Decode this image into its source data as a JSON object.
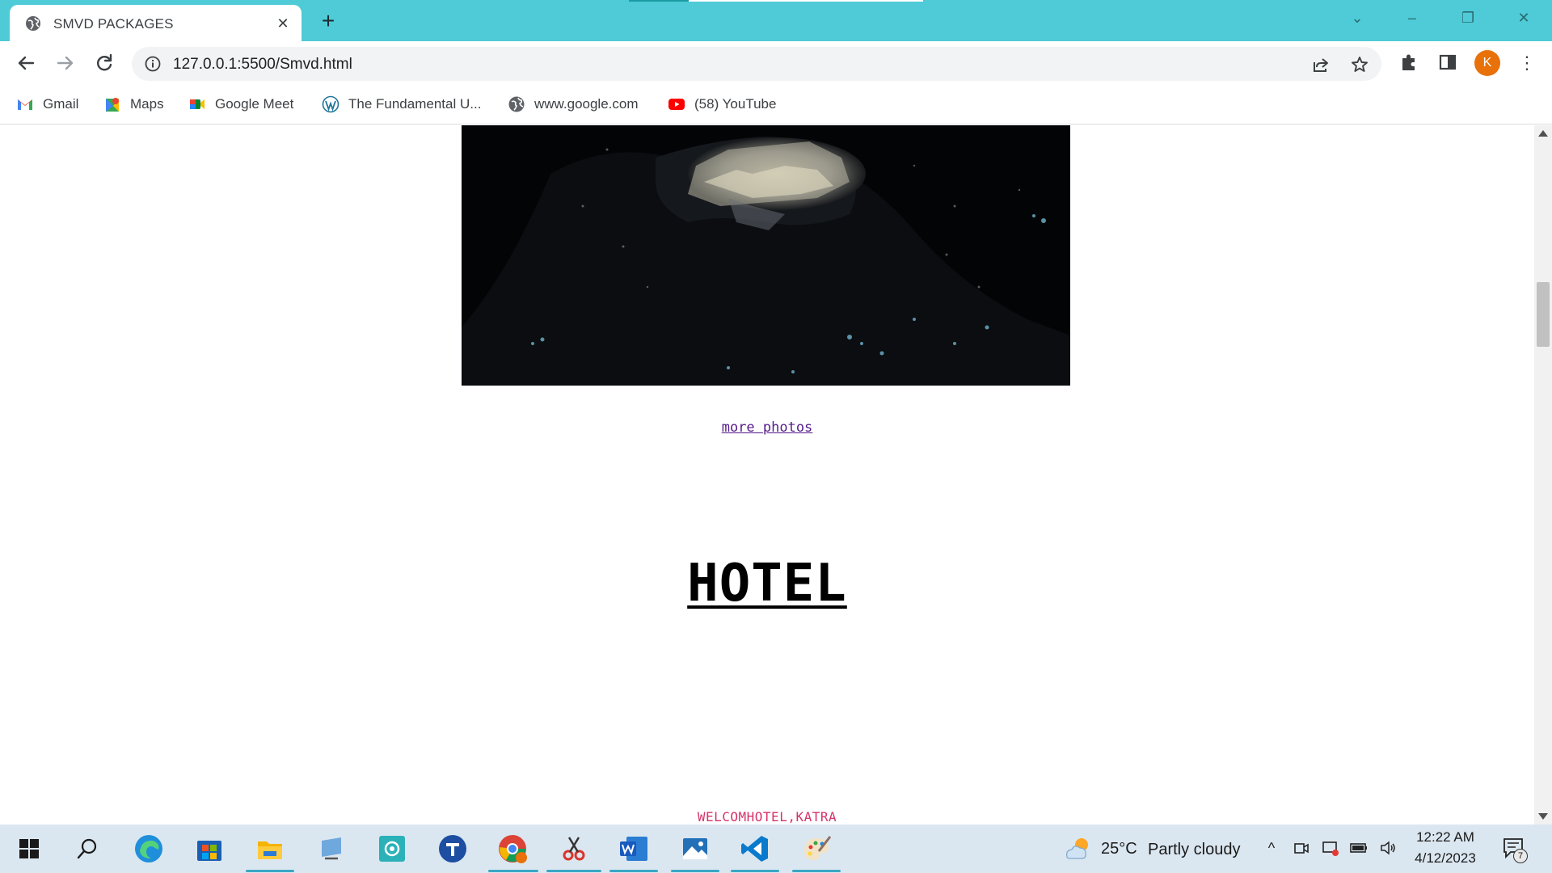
{
  "browser": {
    "tab_title": "SMVD PACKAGES",
    "tab_close": "✕",
    "new_tab": "+",
    "window_controls": {
      "minimize": "–",
      "restore": "❐",
      "close": "✕",
      "tab_search": "⌄"
    },
    "url": "127.0.0.1:5500/Smvd.html",
    "avatar_letter": "K",
    "menu": "⋮",
    "accent_color": "#4ecbd6"
  },
  "bookmarks": [
    {
      "label": "Gmail",
      "icon": "gmail-icon"
    },
    {
      "label": "Maps",
      "icon": "maps-icon"
    },
    {
      "label": "Google Meet",
      "icon": "meet-icon"
    },
    {
      "label": "The Fundamental U...",
      "icon": "wordpress-icon"
    },
    {
      "label": "www.google.com",
      "icon": "globe-icon"
    },
    {
      "label": "(58) YouTube",
      "icon": "youtube-icon"
    }
  ],
  "page": {
    "more_photos_link": "more photos",
    "heading": "HOTEL",
    "hotel_name": "WELCOMHOTEL,KATRA"
  },
  "taskbar": {
    "weather_temp": "25°C",
    "weather_desc": "Partly cloudy",
    "time": "12:22 AM",
    "date": "4/12/2023",
    "notification_count": "7",
    "apps": [
      "start-icon",
      "search-icon",
      "edge-icon",
      "store-icon",
      "file-explorer-icon",
      "remote-desktop-icon",
      "teams-camera-icon",
      "teams-icon",
      "chrome-icon",
      "snipping-tool-icon",
      "word-icon",
      "photos-icon",
      "vscode-icon",
      "paint-icon"
    ]
  }
}
